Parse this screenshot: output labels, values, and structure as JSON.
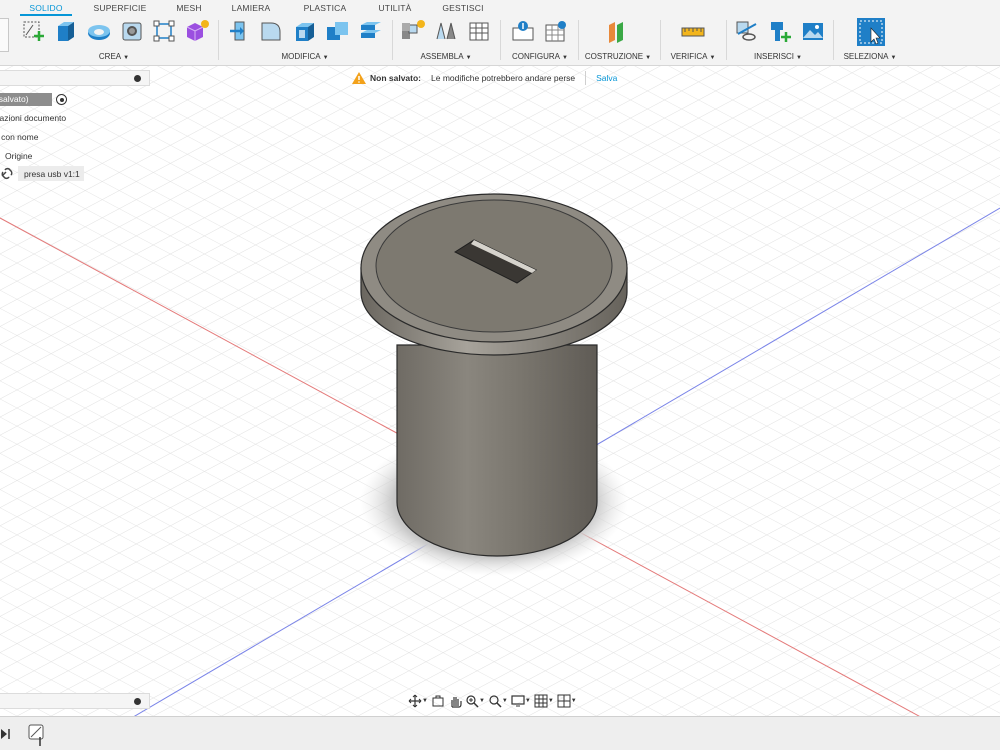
{
  "tabs": [
    "SOLIDO",
    "SUPERFICIE",
    "MESH",
    "LAMIERA",
    "PLASTICA",
    "UTILITÀ",
    "GESTISCI"
  ],
  "toolbar": {
    "groups": {
      "crea": "CREA",
      "modifica": "MODIFICA",
      "assembla": "ASSEMBLA",
      "configura": "CONFIGURA",
      "costruzione": "COSTRUZIONE",
      "verifica": "VERIFICA",
      "inserisci": "INSERISCI",
      "seleziona": "SELEZIONA"
    },
    "accent": "#0696d7"
  },
  "notification": {
    "title": "Non salvato:",
    "message": "Le modifiche potrebbero andare perse",
    "action": "Salva"
  },
  "browser": {
    "root": "(Non salvato)",
    "items": [
      "Impostazioni documento",
      "Viste con nome",
      "Origine",
      "presa usb v1:1"
    ]
  },
  "model": {
    "body_color": "#777269",
    "axis_red": "#e03030",
    "axis_blue": "#3a48e0"
  }
}
